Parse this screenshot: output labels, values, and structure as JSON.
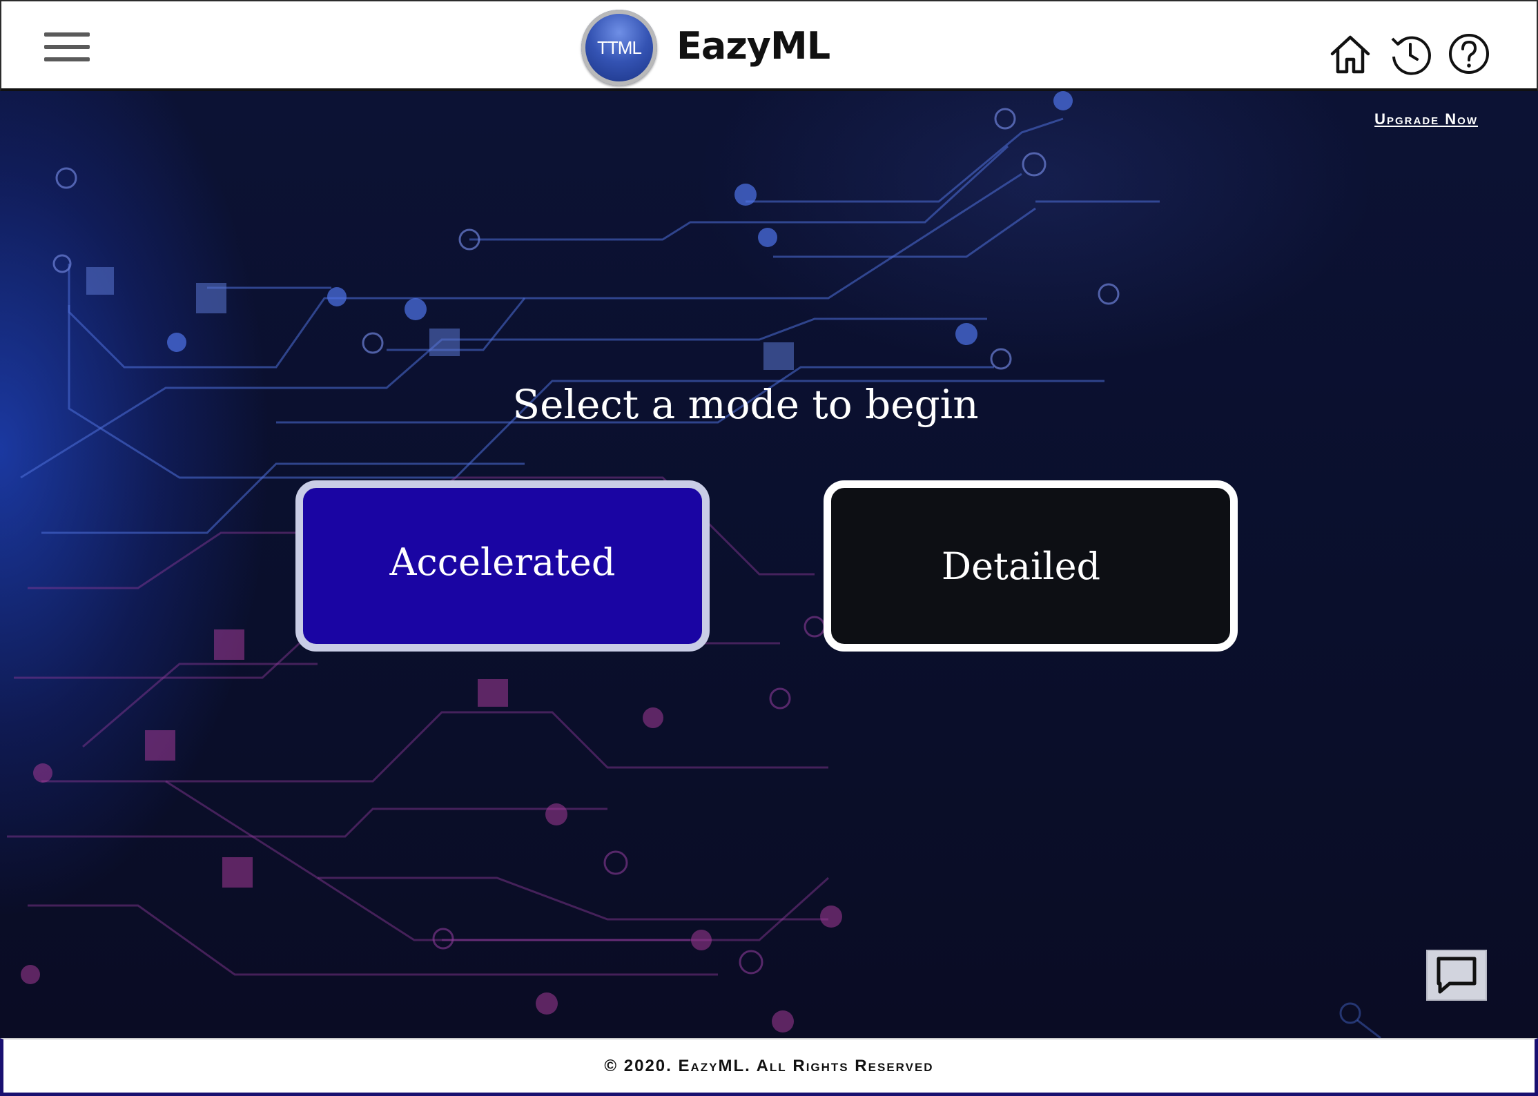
{
  "header": {
    "logo_text": "TTML",
    "brand": "EazyML"
  },
  "main": {
    "upgrade_link": "Upgrade Now",
    "title": "Select a mode to begin",
    "modes": [
      {
        "label": "Accelerated"
      },
      {
        "label": "Detailed"
      }
    ]
  },
  "footer": {
    "copyright": "© 2020. EazyML. All Rights Reserved"
  },
  "icons": {
    "menu": "hamburger-menu-icon",
    "home": "home-icon",
    "history": "history-icon",
    "help": "help-icon",
    "chat": "chat-icon"
  },
  "colors": {
    "accelerated_bg": "#1a05a3",
    "detailed_bg": "#0d0f14",
    "page_bg": "#0b0f2a"
  }
}
